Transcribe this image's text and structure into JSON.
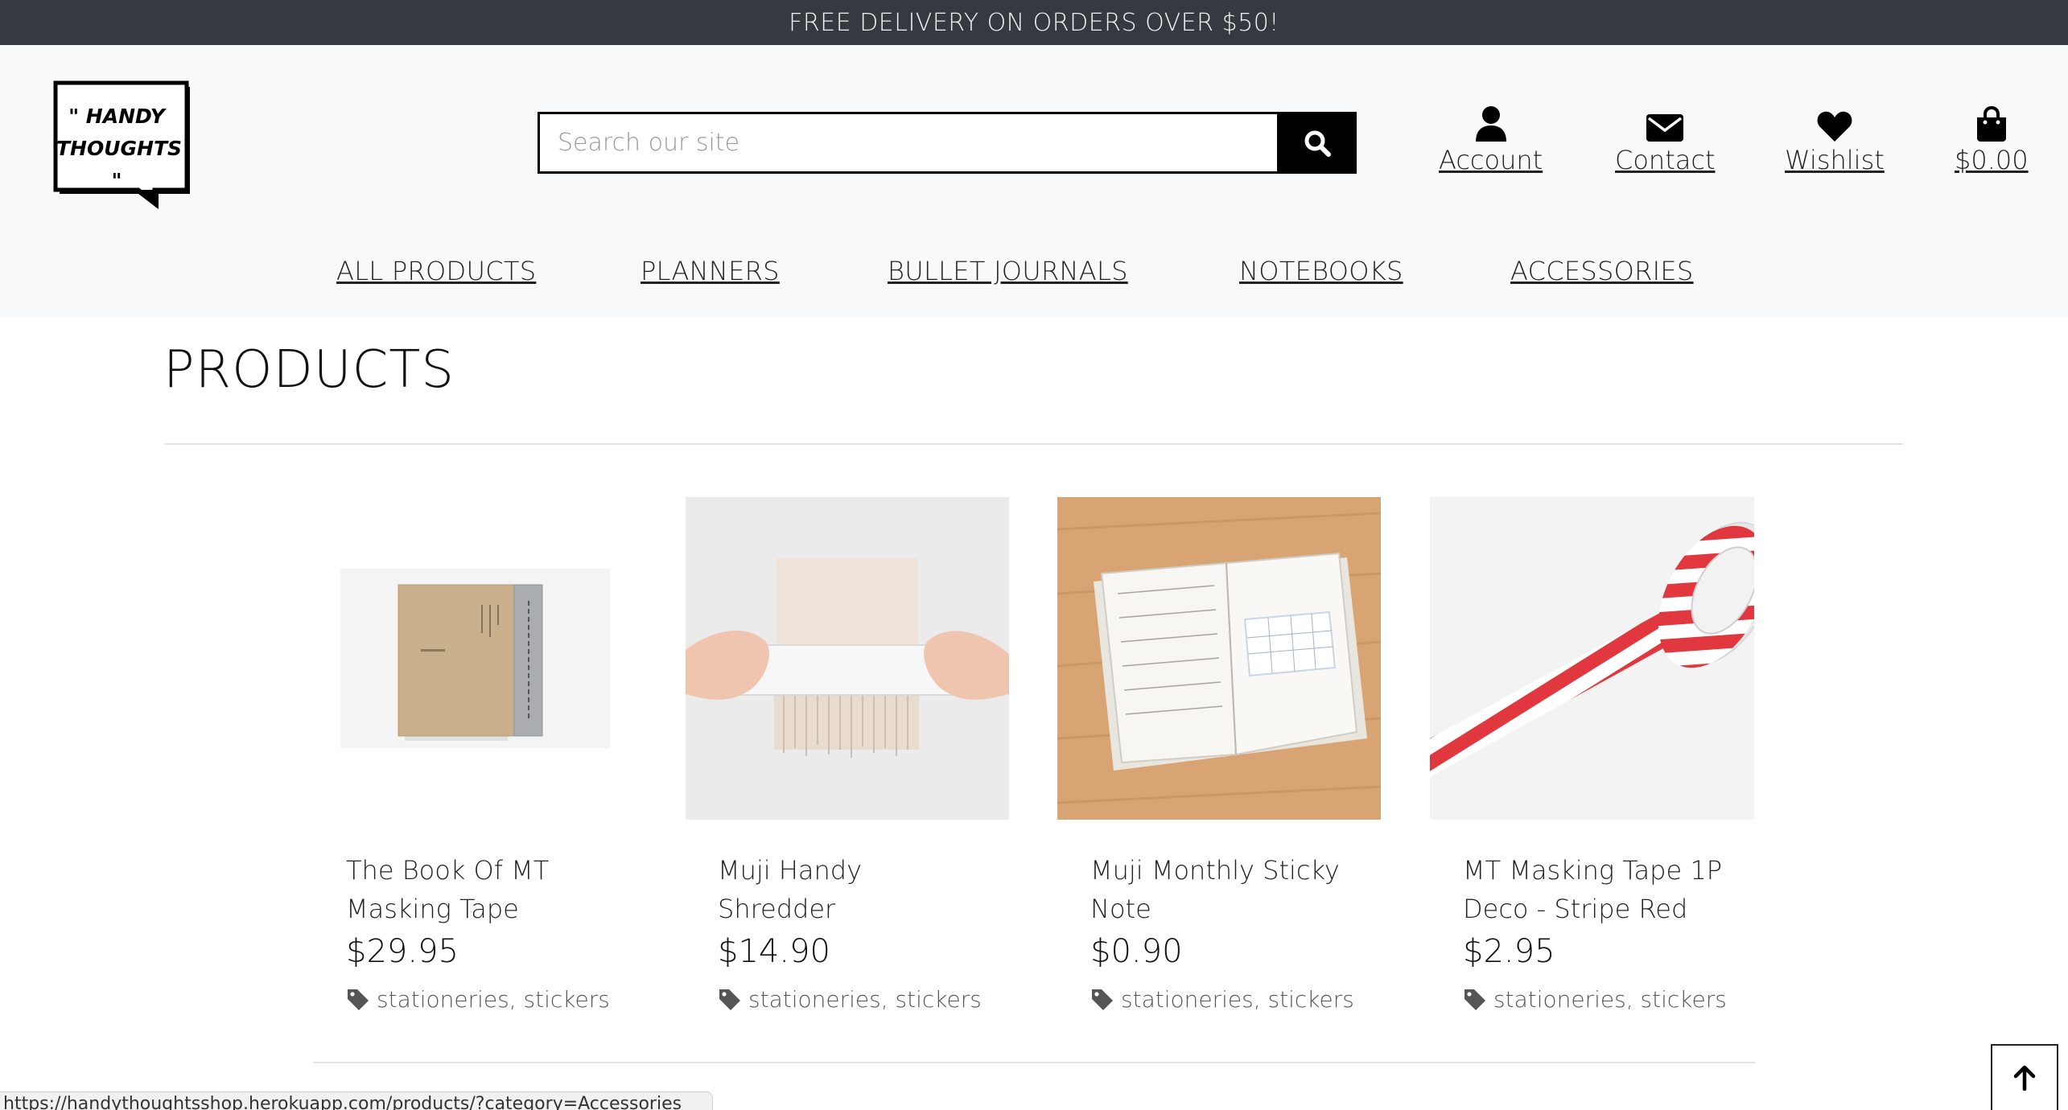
{
  "banner": {
    "text": "FREE DELIVERY ON ORDERS OVER $50!"
  },
  "logo": {
    "line1": "\" HANDY",
    "line2": "THOUGHTS \""
  },
  "search": {
    "placeholder": "Search our site",
    "icon": "search-icon"
  },
  "header_links": {
    "account": {
      "label": "Account",
      "icon": "user-icon"
    },
    "contact": {
      "label": "Contact",
      "icon": "envelope-icon"
    },
    "wishlist": {
      "label": "Wishlist",
      "icon": "heart-icon"
    },
    "cart": {
      "label": "$0.00",
      "icon": "shopping-bag-icon"
    }
  },
  "nav": {
    "all_products": "ALL PRODUCTS",
    "planners": "PLANNERS",
    "bullet_journals": "BULLET JOURNALS",
    "notebooks": "NOTEBOOKS",
    "accessories": "ACCESSORIES"
  },
  "main": {
    "title": "PRODUCTS"
  },
  "products": [
    {
      "name_line1": "The Book Of MT",
      "name_line2": "Masking Tape",
      "price": "$29.95",
      "tag1": "stationeries",
      "tag2": "stickers"
    },
    {
      "name_line1": "Muji Handy",
      "name_line2": "Shredder",
      "price": "$14.90",
      "tag1": "stationeries",
      "tag2": "stickers"
    },
    {
      "name_line1": "Muji Monthly Sticky",
      "name_line2": "Note",
      "price": "$0.90",
      "tag1": "stationeries",
      "tag2": "stickers"
    },
    {
      "name_line1": "MT Masking Tape 1P",
      "name_line2": "Deco - Stripe Red",
      "price": "$2.95",
      "tag1": "stationeries",
      "tag2": "stickers"
    }
  ],
  "status_bar": {
    "url": "https://handythoughtsshop.herokuapp.com/products/?category=Accessories"
  },
  "back_to_top": {
    "icon": "arrow-up-icon"
  }
}
